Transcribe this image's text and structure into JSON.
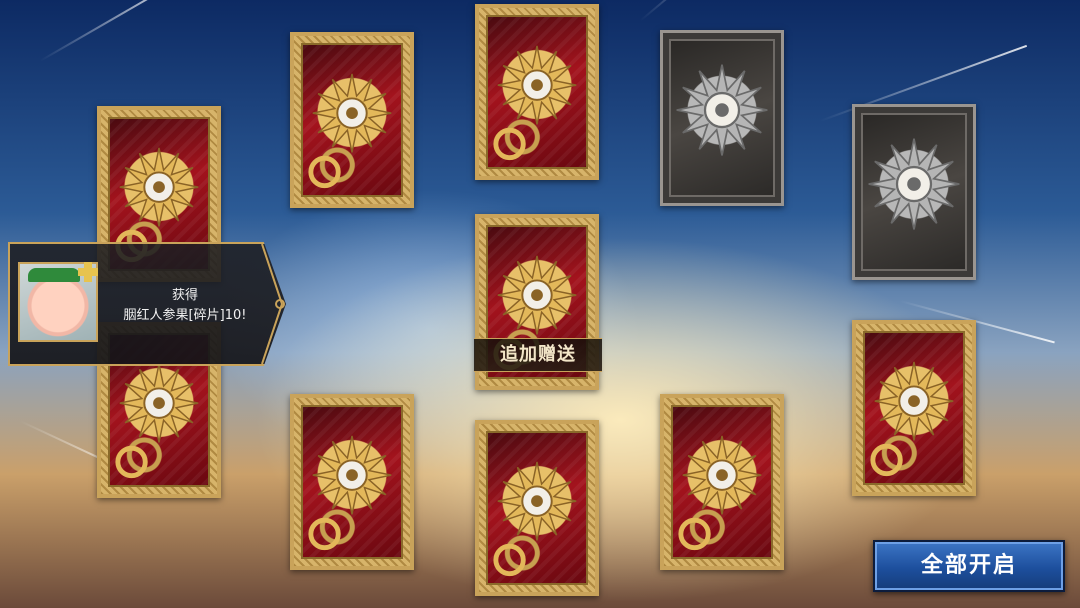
{
  "bonus_card": {
    "label": "追加赠送"
  },
  "reward_toast": {
    "title": "获得",
    "message": "胭红人参果[碎片]10!",
    "item_icon": "ginseng-fruit-avatar",
    "badge_icon": "puzzle-piece-icon"
  },
  "open_all_button": {
    "label": "全部开启"
  },
  "cards": [
    {
      "id": "card-1",
      "style": "gold"
    },
    {
      "id": "card-2",
      "style": "gold"
    },
    {
      "id": "card-3",
      "style": "gold"
    },
    {
      "id": "card-4",
      "style": "silver"
    },
    {
      "id": "card-5",
      "style": "silver"
    },
    {
      "id": "card-6",
      "style": "gold"
    },
    {
      "id": "card-7",
      "style": "gold"
    },
    {
      "id": "card-8",
      "style": "gold"
    },
    {
      "id": "card-9",
      "style": "gold"
    },
    {
      "id": "card-10",
      "style": "gold"
    },
    {
      "id": "card-11",
      "style": "gold"
    },
    {
      "id": "card-12",
      "style": "gold"
    }
  ],
  "colors": {
    "gold_frame": "#c9a35a",
    "card_red": "#a3131d",
    "silver_card": "#3c3a38",
    "button_blue": "#1d4f9d"
  }
}
